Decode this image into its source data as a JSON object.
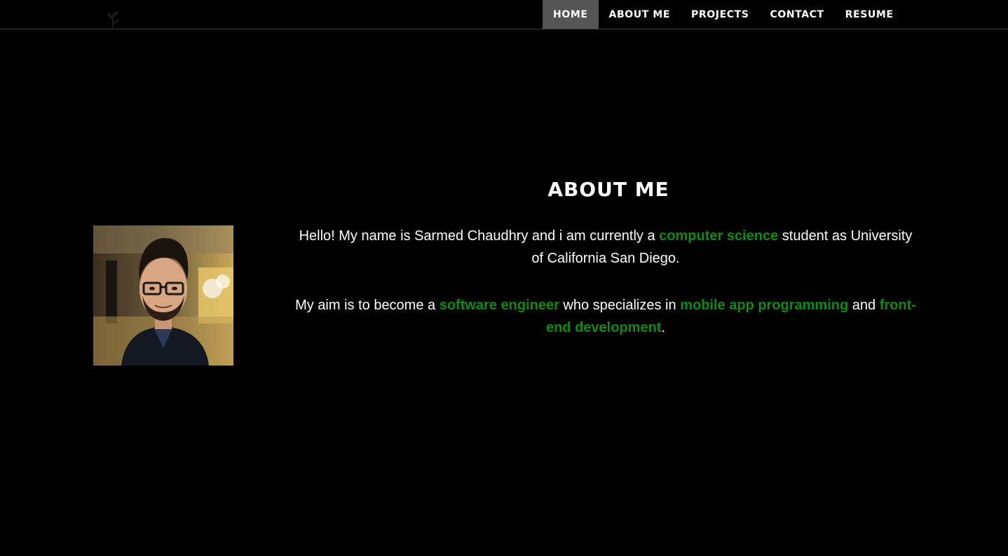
{
  "nav": {
    "items": [
      {
        "label": "HOME",
        "active": true
      },
      {
        "label": "ABOUT ME",
        "active": false
      },
      {
        "label": "PROJECTS",
        "active": false
      },
      {
        "label": "CONTACT",
        "active": false
      },
      {
        "label": "RESUME",
        "active": false
      }
    ],
    "active_bg": "#555555"
  },
  "logo": {
    "icon": "leaf-sprout-icon"
  },
  "about": {
    "title": "ABOUT ME",
    "p1": {
      "t1": "Hello! My name is Sarmed Chaudhry and i am currently a ",
      "h1": "computer science",
      "t2": " student as University of California San Diego."
    },
    "p2": {
      "t1": "My aim is to become a ",
      "h1": "software engineer",
      "t2": " who specializes in ",
      "h2": "mobile app programming",
      "t3": " and ",
      "h3": "front-end development",
      "t4": "."
    }
  },
  "colors": {
    "background": "#000000",
    "text": "#ffffff",
    "highlight": "#0f8a12"
  },
  "photo": {
    "icon": "profile-photo"
  }
}
